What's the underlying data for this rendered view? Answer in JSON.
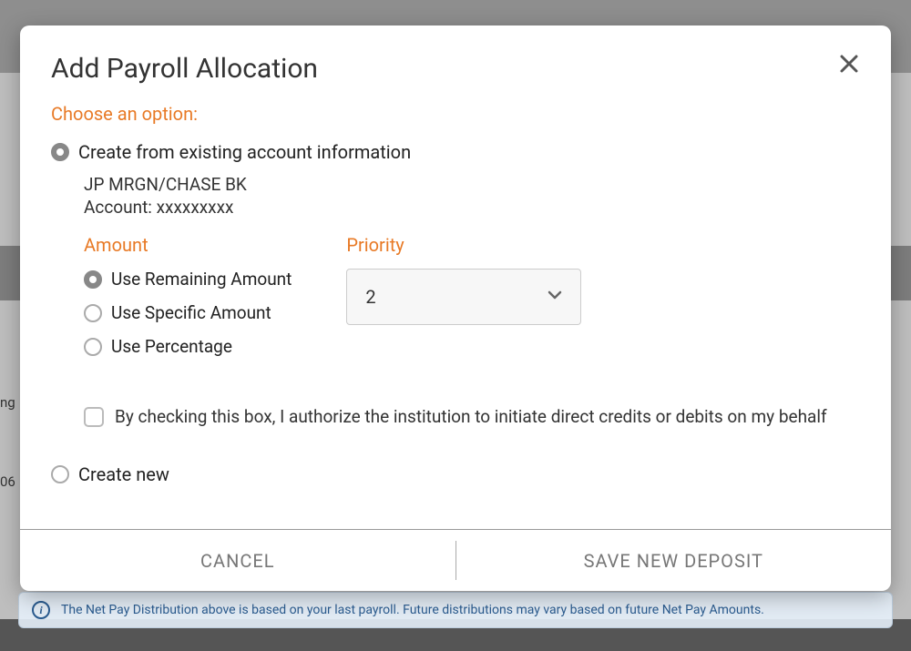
{
  "modal": {
    "title": "Add Payroll Allocation",
    "option_heading": "Choose an option:",
    "option_existing_label": "Create from existing account information",
    "option_new_label": "Create new",
    "account": {
      "bank_name": "JP MRGN/CHASE BK",
      "account_line": "Account: xxxxxxxxx"
    },
    "amount": {
      "label": "Amount",
      "options": {
        "remaining": "Use Remaining Amount",
        "specific": "Use Specific Amount",
        "percentage": "Use Percentage"
      }
    },
    "priority": {
      "label": "Priority",
      "value": "2"
    },
    "authorize_text": "By checking this box, I authorize the institution to initiate direct credits or debits on my behalf",
    "footer": {
      "cancel": "CANCEL",
      "save": "SAVE NEW DEPOSIT"
    }
  },
  "background": {
    "note_text": "The Net Pay Distribution above is based on your last payroll. Future distributions may vary based on future Net Pay Amounts.",
    "partial_left_1": "ng",
    "partial_left_2": "06"
  }
}
